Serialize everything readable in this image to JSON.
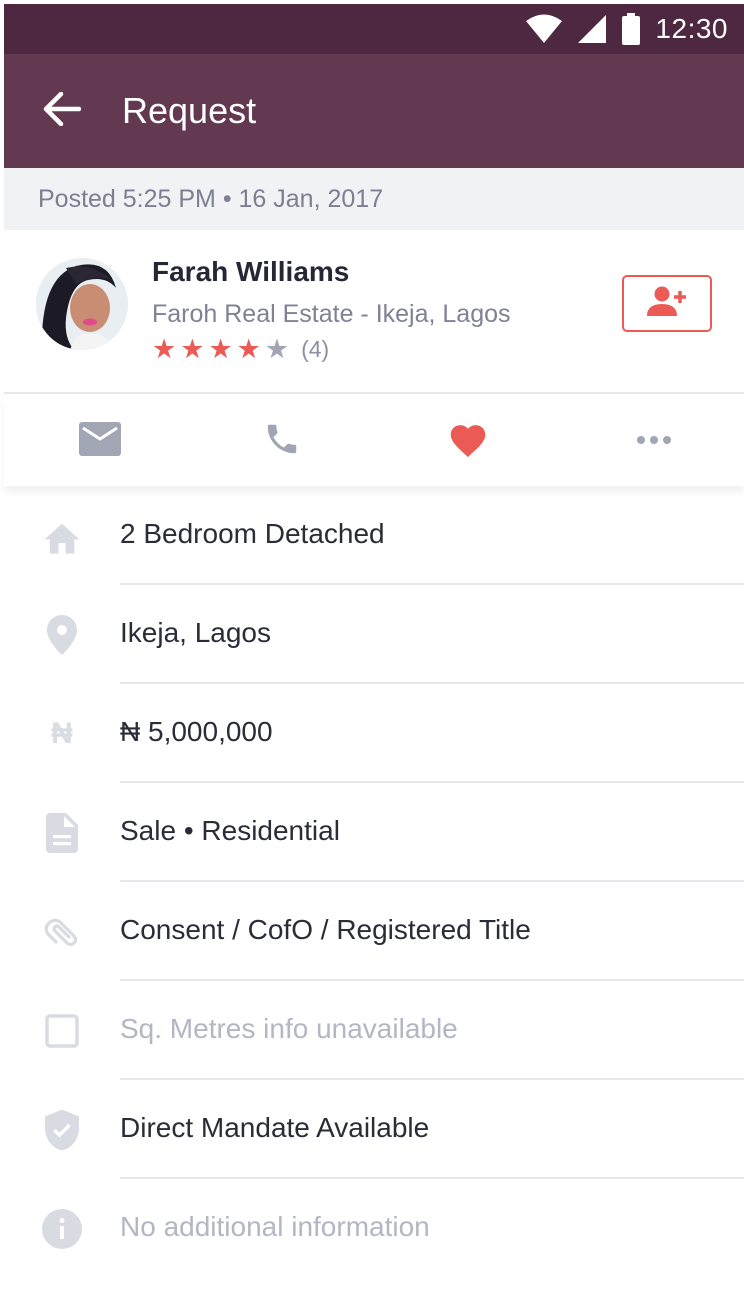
{
  "status_bar": {
    "time": "12:30",
    "icons": [
      "wifi-icon",
      "signal-icon",
      "battery-icon"
    ]
  },
  "app_bar": {
    "title": "Request",
    "back_icon": "arrow-back-icon"
  },
  "posted": "Posted 5:25 PM • 16 Jan, 2017",
  "profile": {
    "name": "Farah Williams",
    "company": "Faroh Real Estate - Ikeja, Lagos",
    "rating": 4,
    "rating_max": 5,
    "rating_count": "(4)",
    "add_contact_icon": "person-add-icon"
  },
  "actions": [
    "mail-icon",
    "phone-icon",
    "heart-icon",
    "more-icon"
  ],
  "details": [
    {
      "icon": "home-icon",
      "text": "2 Bedroom Detached",
      "muted": false
    },
    {
      "icon": "location-pin-icon",
      "text": "Ikeja, Lagos",
      "muted": false
    },
    {
      "icon": "naira-icon",
      "text": "₦ 5,000,000",
      "muted": false
    },
    {
      "icon": "document-icon",
      "text": "Sale • Residential",
      "muted": false
    },
    {
      "icon": "paperclip-icon",
      "text": "Consent / CofO / Registered Title",
      "muted": false
    },
    {
      "icon": "checkbox-icon",
      "text": "Sq. Metres info unavailable",
      "muted": true
    },
    {
      "icon": "shield-check-icon",
      "text": "Direct Mandate Available",
      "muted": false
    },
    {
      "icon": "info-icon",
      "text": "No additional information",
      "muted": true
    }
  ],
  "colors": {
    "status_bar": "#4e2840",
    "app_bar": "#633851",
    "accent": "#ec5a56",
    "icon_grey": "#a2a5b4"
  }
}
